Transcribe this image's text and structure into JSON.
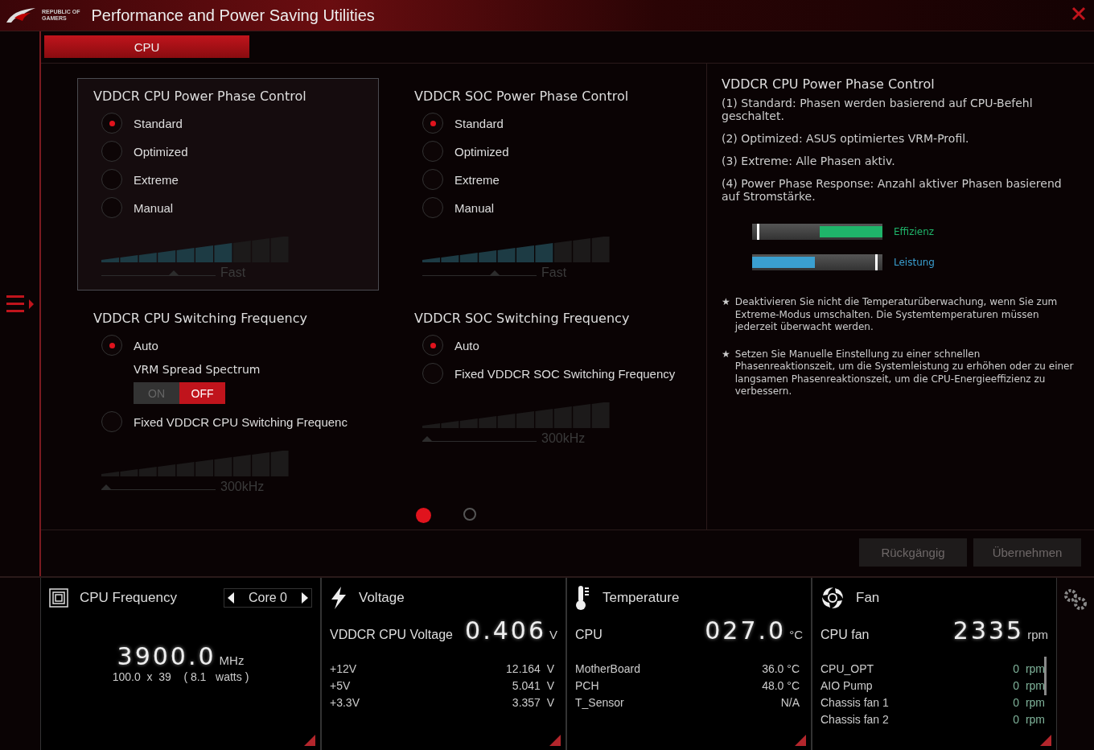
{
  "window": {
    "logo_text": [
      "REPUBLIC OF",
      "GAMERS"
    ],
    "title": "Performance and Power Saving Utilities"
  },
  "tabs": [
    {
      "label": "CPU",
      "selected": true
    }
  ],
  "columns": [
    [
      {
        "title": "VDDCR CPU Power Phase Control",
        "highlighted": true,
        "options": [
          {
            "label": "Standard",
            "selected": true
          },
          {
            "label": "Optimized",
            "selected": false
          },
          {
            "label": "Extreme",
            "selected": false
          },
          {
            "label": "Manual",
            "selected": false
          }
        ],
        "slider": {
          "label": "Fast",
          "level": 0.65
        }
      },
      {
        "title": "VDDCR CPU Switching Frequency",
        "highlighted": false,
        "options": [
          {
            "label": "Auto",
            "selected": true,
            "sub": {
              "label": "VRM Spread Spectrum",
              "on_label": "ON",
              "off_label": "OFF",
              "on": false
            }
          },
          {
            "label": "Fixed VDDCR CPU Switching Frequenc",
            "selected": false
          }
        ],
        "slider": {
          "label": "300kHz",
          "level": 0
        }
      }
    ],
    [
      {
        "title": "VDDCR SOC Power Phase Control",
        "highlighted": false,
        "options": [
          {
            "label": "Standard",
            "selected": true
          },
          {
            "label": "Optimized",
            "selected": false
          },
          {
            "label": "Extreme",
            "selected": false
          },
          {
            "label": "Manual",
            "selected": false
          }
        ],
        "slider": {
          "label": "Fast",
          "level": 0.65
        }
      },
      {
        "title": "VDDCR SOC Switching Frequency",
        "highlighted": false,
        "options": [
          {
            "label": "Auto",
            "selected": true
          },
          {
            "label": "Fixed VDDCR SOC Switching Frequency",
            "selected": false
          }
        ],
        "slider": {
          "label": "300kHz",
          "level": 0
        }
      }
    ]
  ],
  "pages": [
    {
      "selected": true
    },
    {
      "selected": false
    }
  ],
  "help": {
    "title": "VDDCR CPU Power Phase Control",
    "paragraphs": [
      "(1) Standard: Phasen werden basierend auf CPU-Befehl geschaltet.",
      "(2) Optimized: ASUS optimiertes VRM-Profil.",
      "(3) Extreme: Alle Phasen aktiv.",
      "(4) Power Phase Response: Anzahl aktiver Phasen basierend auf Stromstärke."
    ],
    "bars": [
      {
        "kind": "efficiency",
        "label": "Effizienz",
        "level": 0.48
      },
      {
        "kind": "performance",
        "label": "Leistung",
        "level": 0.48
      }
    ],
    "notes": [
      {
        "bullet": "★",
        "text": "Deaktivieren Sie nicht die Temperaturüberwachung, wenn Sie zum Extreme-Modus umschalten. Die Systemtemperaturen müssen jederzeit überwacht werden."
      },
      {
        "bullet": "★",
        "text": "Setzen Sie Manuelle Einstellung zu einer schnellen Phasenreaktionszeit, um die Systemleistung zu erhöhen oder zu einer langsamen Phasenreaktionszeit, um die CPU-Energieeffizienz zu verbessern."
      }
    ]
  },
  "buttons": [
    {
      "label": "Rückgängig",
      "disabled": true
    },
    {
      "label": "Übernehmen",
      "disabled": true
    }
  ],
  "monitors": [
    {
      "kind": "frequency",
      "title": "CPU Frequency",
      "selector": "Core 0",
      "value": "3900.0",
      "unit": "MHz",
      "detail": "100.0  x  39    ( 8.1   watts )"
    },
    {
      "kind": "voltage",
      "title": "Voltage",
      "main_label": "VDDCR CPU Voltage",
      "value": "0.406",
      "unit": "V",
      "rows": [
        {
          "name": "+12V",
          "value": "12.164  V"
        },
        {
          "name": "+5V",
          "value": "5.041  V"
        },
        {
          "name": "+3.3V",
          "value": "3.357  V"
        }
      ]
    },
    {
      "kind": "temperature",
      "title": "Temperature",
      "main_label": "CPU",
      "value": "027.0",
      "unit": "°C",
      "rows": [
        {
          "name": "MotherBoard",
          "value": "36.0 °C"
        },
        {
          "name": "PCH",
          "value": "48.0 °C"
        },
        {
          "name": "T_Sensor",
          "value": "N/A"
        }
      ]
    },
    {
      "kind": "fan",
      "title": "Fan",
      "main_label": "CPU fan",
      "value": "2335",
      "unit": "rpm",
      "rows": [
        {
          "name": "CPU_OPT",
          "value": "0  rpm"
        },
        {
          "name": "AIO Pump",
          "value": "0  rpm"
        },
        {
          "name": "Chassis fan 1",
          "value": "0  rpm"
        },
        {
          "name": "Chassis fan 2",
          "value": "0  rpm"
        }
      ]
    }
  ]
}
